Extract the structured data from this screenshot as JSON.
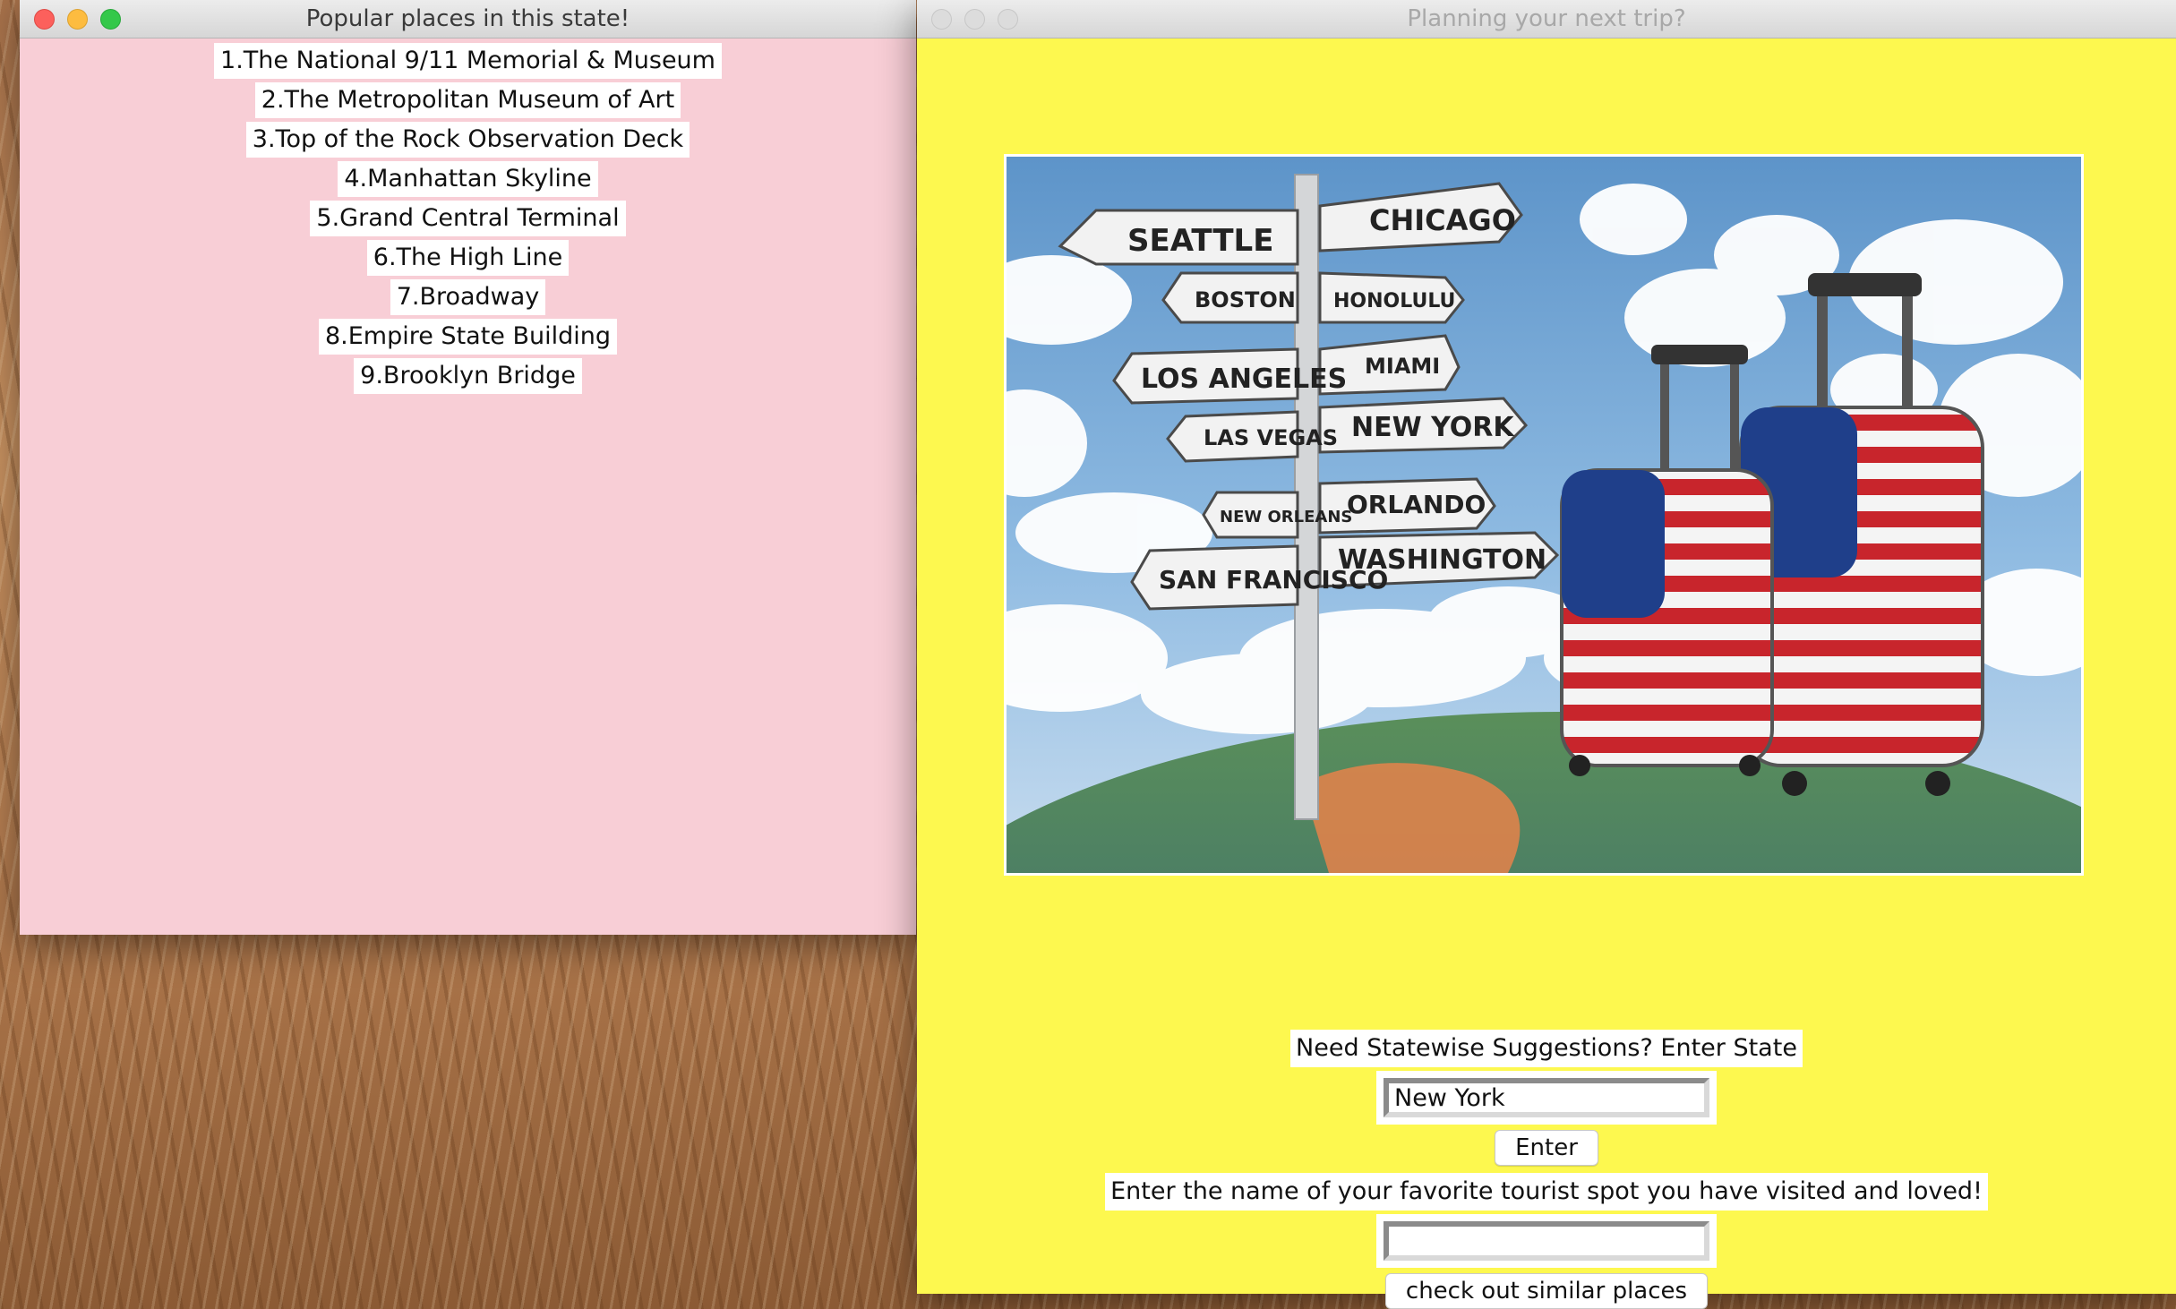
{
  "left_window": {
    "title": "Popular places in this state!",
    "places": [
      "1.The National 9/11 Memorial & Museum",
      "2.The Metropolitan Museum of Art",
      "3.Top of the Rock Observation Deck",
      "4.Manhattan Skyline",
      "5.Grand Central Terminal",
      "6.The High Line",
      "7.Broadway",
      "8.Empire State Building",
      "9.Brooklyn Bridge"
    ],
    "background_color": "#f8ced6"
  },
  "right_window": {
    "title": "Planning your next trip?",
    "background_color": "#fdf84f",
    "hero_image": {
      "signs": [
        "SEATTLE",
        "CHICAGO",
        "BOSTON",
        "HONOLULU",
        "LOS ANGELES",
        "MIAMI",
        "LAS VEGAS",
        "NEW YORK",
        "NEW ORLEANS",
        "ORLANDO",
        "SAN FRANCISCO",
        "WASHINGTON"
      ]
    },
    "state_prompt": "Need Statewise Suggestions? Enter State",
    "state_input_value": "New York",
    "enter_button": "Enter",
    "favorite_prompt": "Enter the name of your favorite tourist spot you have visited and loved!",
    "favorite_input_value": "",
    "similar_button": "check out similar places"
  }
}
